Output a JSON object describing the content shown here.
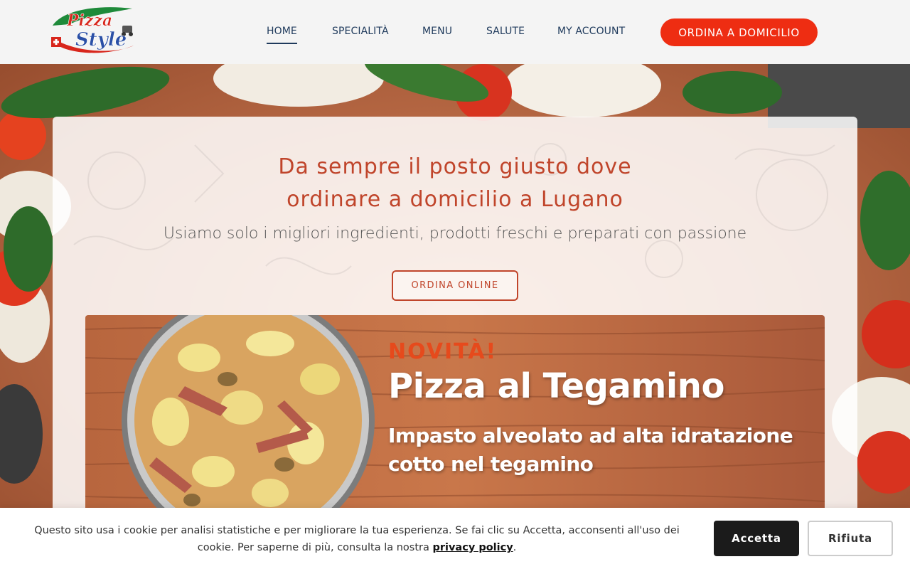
{
  "brand": {
    "logo_line1": "Pizza",
    "logo_line2": "Style"
  },
  "nav": {
    "items": [
      {
        "label": "HOME",
        "active": true
      },
      {
        "label": "SPECIALITÀ",
        "active": false
      },
      {
        "label": "MENU",
        "active": false
      },
      {
        "label": "SALUTE",
        "active": false
      },
      {
        "label": "MY ACCOUNT",
        "active": false
      }
    ],
    "cta_label": "ORDINA A DOMICILIO"
  },
  "hero": {
    "headline_line1": "Da sempre il posto giusto dove",
    "headline_line2": "ordinare a domicilio a Lugano",
    "subline": "Usiamo solo i migliori ingredienti, prodotti freschi e preparati con passione",
    "cta_label": "ORDINA ONLINE"
  },
  "promo": {
    "kicker": "NOVITÀ!",
    "title": "Pizza al Tegamino",
    "sub_line1": "Impasto alveolato ad alta idratazione",
    "sub_line2": "cotto nel tegamino"
  },
  "cookie": {
    "text_line1": "Questo sito usa i cookie per analisi statistiche e per migliorare la tua esperienza. Se fai clic su Accetta, acconsenti all'uso dei",
    "text_line2_pre": "cookie. Per saperne di più, consulta la nostra ",
    "link_label": "privacy policy",
    "text_line2_post": ".",
    "accept_label": "Accetta",
    "reject_label": "Rifiuta"
  },
  "colors": {
    "accent_red": "#ee2d12",
    "headline_red": "#c0452b",
    "nav_blue": "#1f3a5c",
    "dark_button": "#1b1b1b"
  }
}
